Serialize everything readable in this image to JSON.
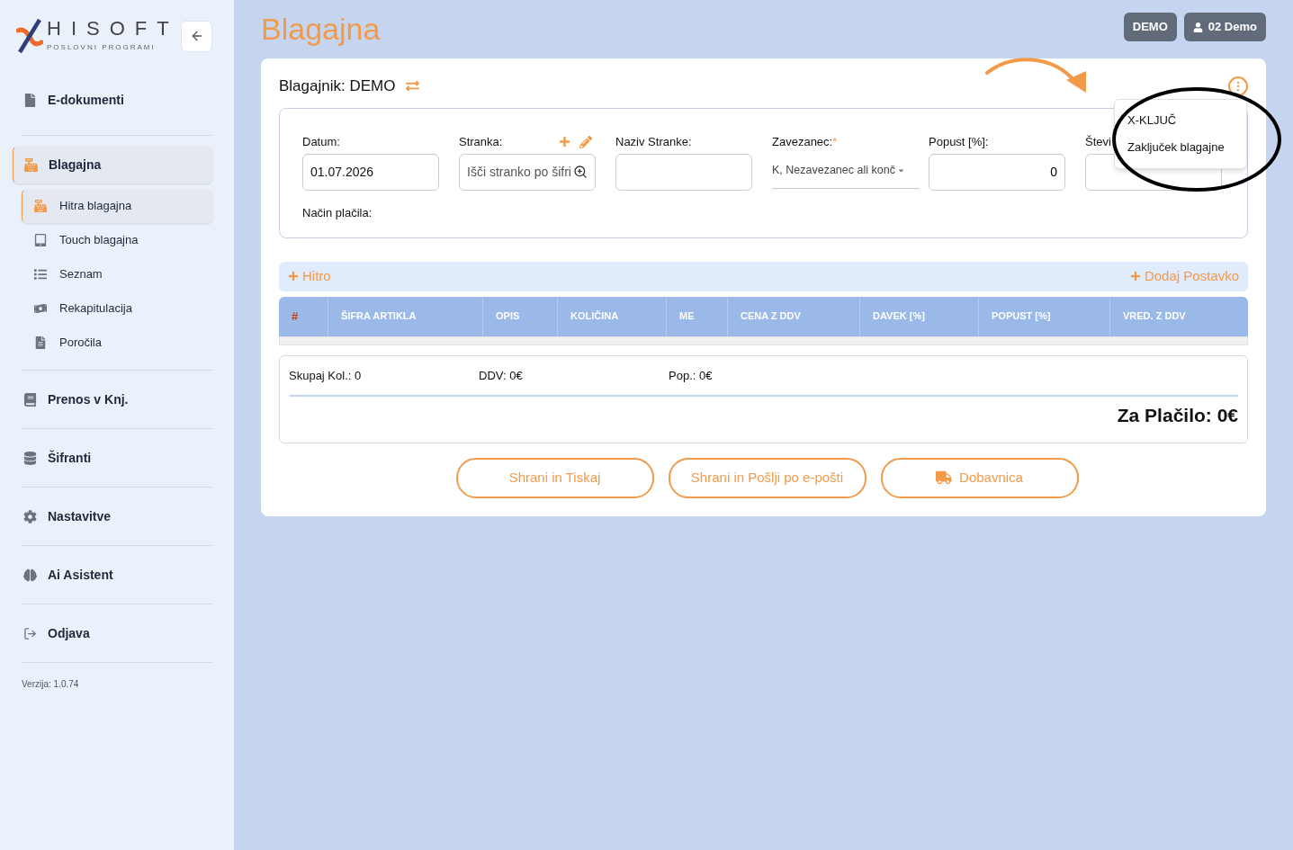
{
  "sidebar": {
    "logo": {
      "name": "HISOFT",
      "tagline": "POSLOVNI PROGRAMI"
    },
    "items": [
      {
        "label": "E-dokumenti",
        "selected": false
      },
      {
        "label": "Blagajna",
        "selected": true,
        "children": [
          {
            "label": "Hitra blagajna",
            "selected": true
          },
          {
            "label": "Touch blagajna",
            "selected": false
          },
          {
            "label": "Seznam",
            "selected": false
          },
          {
            "label": "Rekapitulacija",
            "selected": false
          },
          {
            "label": "Poročila",
            "selected": false
          }
        ]
      },
      {
        "label": "Prenos v Knj.",
        "selected": false
      },
      {
        "label": "Šifranti",
        "selected": false
      },
      {
        "label": "Nastavitve",
        "selected": false
      },
      {
        "label": "Ai Asistent",
        "selected": false
      },
      {
        "label": "Odjava",
        "selected": false
      }
    ],
    "version": "Verzija: 1.0.74"
  },
  "header": {
    "title": "Blagajna",
    "badges": [
      {
        "label": "DEMO",
        "kind": "plain"
      },
      {
        "label": "02 Demo",
        "kind": "user"
      }
    ]
  },
  "cashier": {
    "label": "Blagajnik: DEMO"
  },
  "form": {
    "fields": [
      {
        "label": "Datum:",
        "value": "01.07.2026",
        "kind": "input"
      },
      {
        "label": "Stranka:",
        "placeholder": "Išči stranko po šifri",
        "kind": "search"
      },
      {
        "label": "Naziv Stranke:",
        "kind": "input"
      },
      {
        "label": "Zavezanec:",
        "marker": "*",
        "value": "K, Nezavezanec ali konč",
        "kind": "select"
      },
      {
        "label": "Popust [%]:",
        "value": "0",
        "kind": "number"
      },
      {
        "label": "Števi",
        "kind": "input"
      }
    ],
    "payment_label": "Način plačila:"
  },
  "menu": {
    "items": [
      "X-KLJUČ",
      "Zaključek blagajne"
    ]
  },
  "toolbar": {
    "left": "Hitro",
    "right": "Dodaj Postavko"
  },
  "table": {
    "columns": [
      "#",
      "ŠIFRA ARTIKLA",
      "OPIS",
      "KOLIČINA",
      "ME",
      "CENA Z DDV",
      "DAVEK [%]",
      "POPUST [%]",
      "VRED. Z DDV"
    ]
  },
  "summary": {
    "items": [
      "Skupaj Kol.: 0",
      "DDV: 0€",
      "Pop.: 0€"
    ],
    "total": "Za Plačilo: 0€"
  },
  "actions": [
    {
      "label": "Shrani in Tiskaj",
      "kind": "plain"
    },
    {
      "label": "Shrani in Pošlji po e-pošti",
      "kind": "plain"
    },
    {
      "label": "Dobavnica",
      "kind": "truck"
    }
  ]
}
